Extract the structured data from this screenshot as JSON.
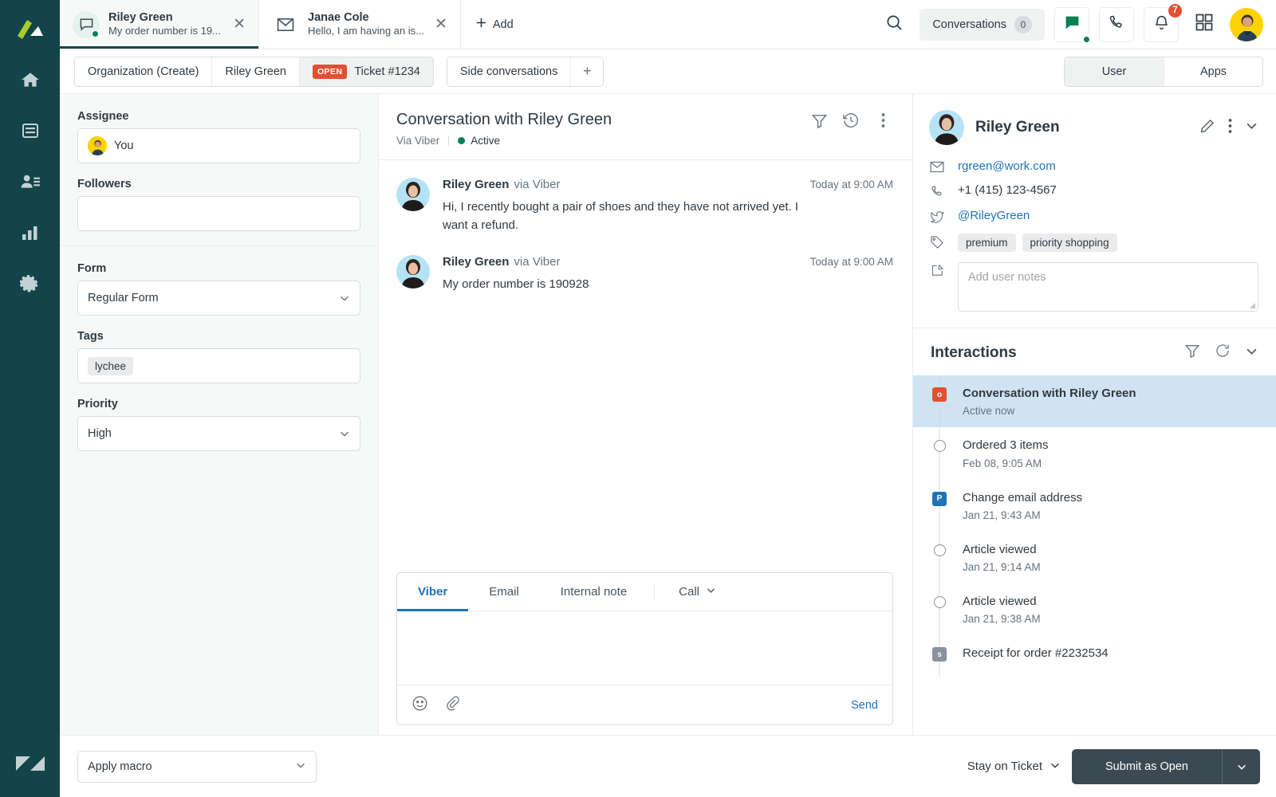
{
  "nav": {
    "logo_icon": "zendesk-logo-icon",
    "items": [
      {
        "icon": "home-icon",
        "name": "home"
      },
      {
        "icon": "views-icon",
        "name": "views"
      },
      {
        "icon": "customers-icon",
        "name": "customers"
      },
      {
        "icon": "reporting-icon",
        "name": "reporting"
      },
      {
        "icon": "gear-icon",
        "name": "admin"
      }
    ],
    "bottom_icon": "zendesk-wordmark-icon"
  },
  "topbar": {
    "tabs": [
      {
        "title": "Riley Green",
        "subtitle": "My order number is 19...",
        "icon": "chat-bubble-icon",
        "active": true,
        "online": true
      },
      {
        "title": "Janae Cole",
        "subtitle": "Hello, I am having an is...",
        "icon": "envelope-icon",
        "active": false,
        "online": false
      }
    ],
    "add_label": "Add",
    "search_icon": "search-icon",
    "conversations_label": "Conversations",
    "conversations_count": "0",
    "chat_icon": "chat-status-icon",
    "call_icon": "phone-icon",
    "bell_icon": "bell-icon",
    "notification_count": "7",
    "apps_grid_icon": "apps-grid-icon",
    "avatar_name": "agent-avatar"
  },
  "crumbs": {
    "items": [
      {
        "label": "Organization (Create)",
        "badge": null,
        "current": false
      },
      {
        "label": "Riley Green",
        "badge": null,
        "current": false
      },
      {
        "label": "Ticket #1234",
        "badge": "OPEN",
        "current": true
      }
    ],
    "side_conversations": "Side conversations",
    "plus_icon": "plus-icon",
    "segments": [
      {
        "label": "User",
        "active": true
      },
      {
        "label": "Apps",
        "active": false
      }
    ]
  },
  "properties": {
    "assignee_label": "Assignee",
    "assignee_value": "You",
    "followers_label": "Followers",
    "followers_value": "",
    "form_label": "Form",
    "form_value": "Regular Form",
    "tags_label": "Tags",
    "tags": [
      "lychee"
    ],
    "priority_label": "Priority",
    "priority_value": "High"
  },
  "conversation": {
    "title": "Conversation with Riley Green",
    "via": "Via Viber",
    "status": "Active",
    "filter_icon": "filter-icon",
    "history_icon": "history-icon",
    "more_icon": "more-vertical-icon",
    "messages": [
      {
        "author": "Riley Green",
        "via": "via Viber",
        "time": "Today at 9:00 AM",
        "text": "Hi, I recently bought a pair of shoes and they have not arrived yet. I want a refund."
      },
      {
        "author": "Riley Green",
        "via": "via Viber",
        "time": "Today at 9:00 AM",
        "text": "My order number is 190928"
      }
    ]
  },
  "composer": {
    "tabs": [
      {
        "label": "Viber",
        "active": true
      },
      {
        "label": "Email",
        "active": false
      },
      {
        "label": "Internal note",
        "active": false
      }
    ],
    "call_label": "Call",
    "editor_value": "",
    "emoji_icon": "emoji-icon",
    "attach_icon": "paperclip-icon",
    "send_label": "Send"
  },
  "actionbar": {
    "macro_placeholder": "Apply macro",
    "stay_label": "Stay on Ticket",
    "submit_label": "Submit as Open",
    "submit_caret_icon": "chevron-down-icon"
  },
  "user_panel": {
    "name": "Riley Green",
    "edit_icon": "pencil-icon",
    "more_icon": "more-vertical-icon",
    "collapse_icon": "chevron-down-icon",
    "email": "rgreen@work.com",
    "email_icon": "envelope-icon",
    "phone": "+1 (415) 123-4567",
    "phone_icon": "phone-icon",
    "twitter": "@RileyGreen",
    "twitter_icon": "twitter-icon",
    "tags_icon": "tag-icon",
    "tags": [
      "premium",
      "priority shopping"
    ],
    "notes_icon": "notes-icon",
    "notes_placeholder": "Add user notes"
  },
  "interactions": {
    "title": "Interactions",
    "filter_icon": "filter-icon",
    "refresh_icon": "refresh-icon",
    "collapse_icon": "chevron-down-icon",
    "items": [
      {
        "label": "Conversation with Riley Green",
        "time": "Active now",
        "marker": "square-orange",
        "marker_letter": "o",
        "selected": true
      },
      {
        "label": "Ordered 3 items",
        "time": "Feb 08, 9:05 AM",
        "marker": "circle",
        "marker_letter": "",
        "selected": false
      },
      {
        "label": "Change email address",
        "time": "Jan 21, 9:43 AM",
        "marker": "square-blue",
        "marker_letter": "P",
        "selected": false
      },
      {
        "label": "Article viewed",
        "time": "Jan 21, 9:14 AM",
        "marker": "circle",
        "marker_letter": "",
        "selected": false
      },
      {
        "label": "Article viewed",
        "time": "Jan 21, 9:38 AM",
        "marker": "circle",
        "marker_letter": "",
        "selected": false
      },
      {
        "label": "Receipt for order #2232534",
        "time": "",
        "marker": "square-gray",
        "marker_letter": "s",
        "selected": false
      }
    ]
  },
  "colors": {
    "nav_bg": "#12444a",
    "accent_blue": "#1f73b7",
    "open_red": "#e34f32",
    "active_green": "#038153",
    "panel_bg": "#f7f9f9",
    "selected_row": "#cfe3f2",
    "submit_dark": "#3b4a52"
  }
}
